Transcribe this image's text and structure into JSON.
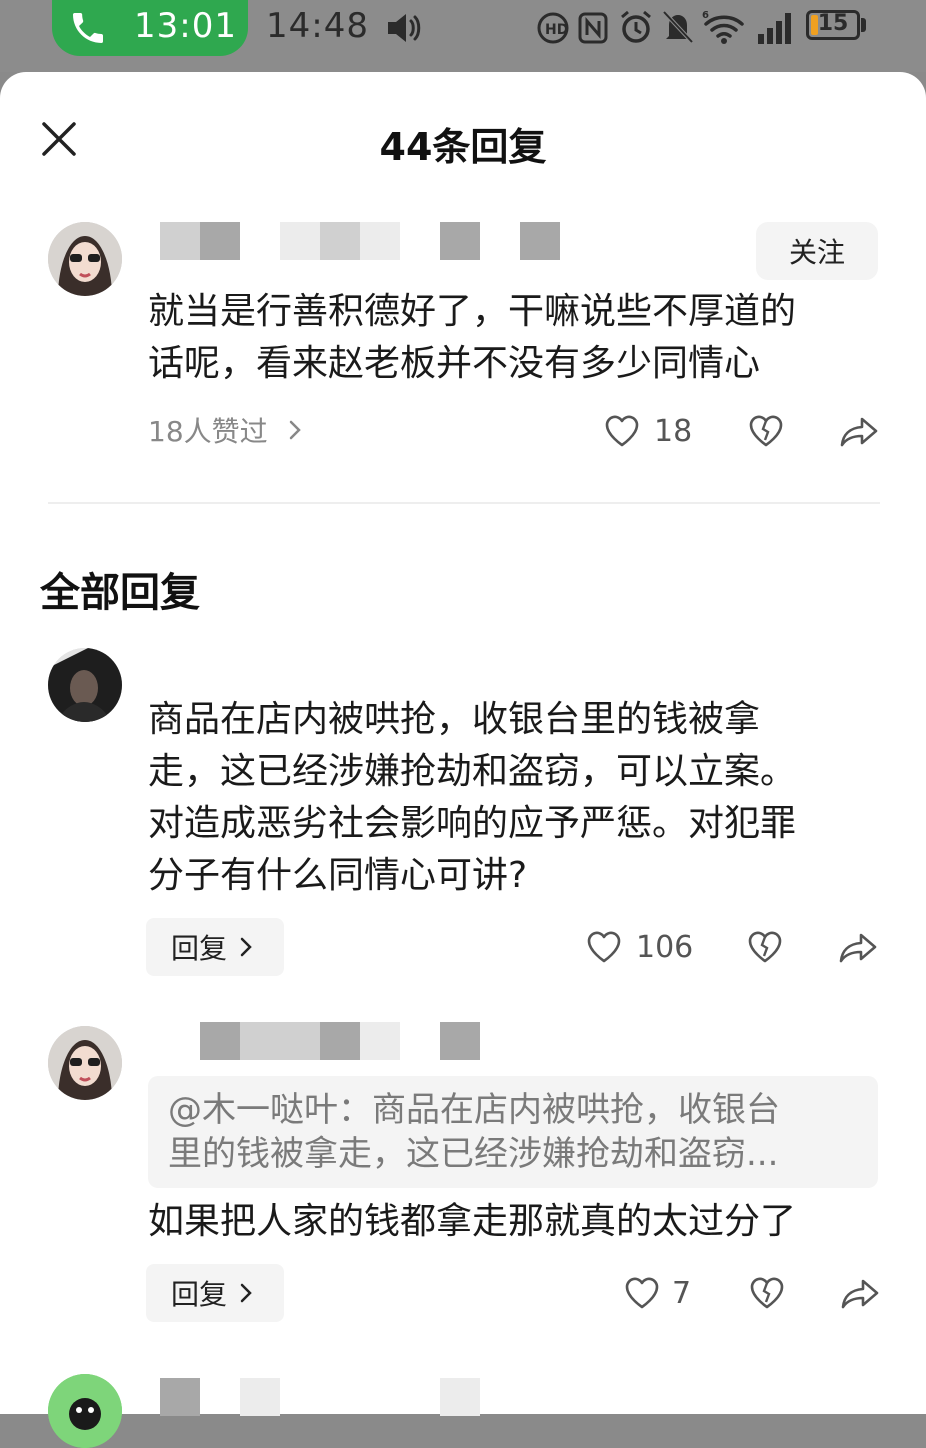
{
  "status_bar": {
    "call_time": "13:01",
    "clock": "14:48",
    "battery_level": "15",
    "icons": [
      "phone-icon",
      "volume-icon",
      "hd-icon",
      "nfc-icon",
      "alarm-icon",
      "mute-icon",
      "wifi-icon",
      "signal-icon",
      "battery-icon"
    ],
    "call_color": "#2fa84f",
    "battery_color": "#f0a020"
  },
  "header": {
    "title": "44条回复"
  },
  "main_comment": {
    "follow_label": "关注",
    "text_lines": [
      "就当是行善积德好了，干嘛说些不厚道的",
      "话呢，看来赵老板并不没有多少同情心"
    ],
    "likes_summary": "18人赞过",
    "like_count": "18"
  },
  "section_title": "全部回复",
  "replies": [
    {
      "text_lines": [
        "商品在店内被哄抢，收银台里的钱被拿",
        "走，这已经涉嫌抢劫和盗窃，可以立案。",
        "对造成恶劣社会影响的应予严惩。对犯罪",
        "分子有什么同情心可讲?"
      ],
      "reply_label": "回复",
      "like_count": "106"
    },
    {
      "quote_lines": [
        "@木一哒叶：商品在店内被哄抢，收银台",
        "里的钱被拿走，这已经涉嫌抢劫和盗窃..."
      ],
      "text": "如果把人家的钱都拿走那就真的太过分了",
      "reply_label": "回复",
      "like_count": "7"
    }
  ]
}
